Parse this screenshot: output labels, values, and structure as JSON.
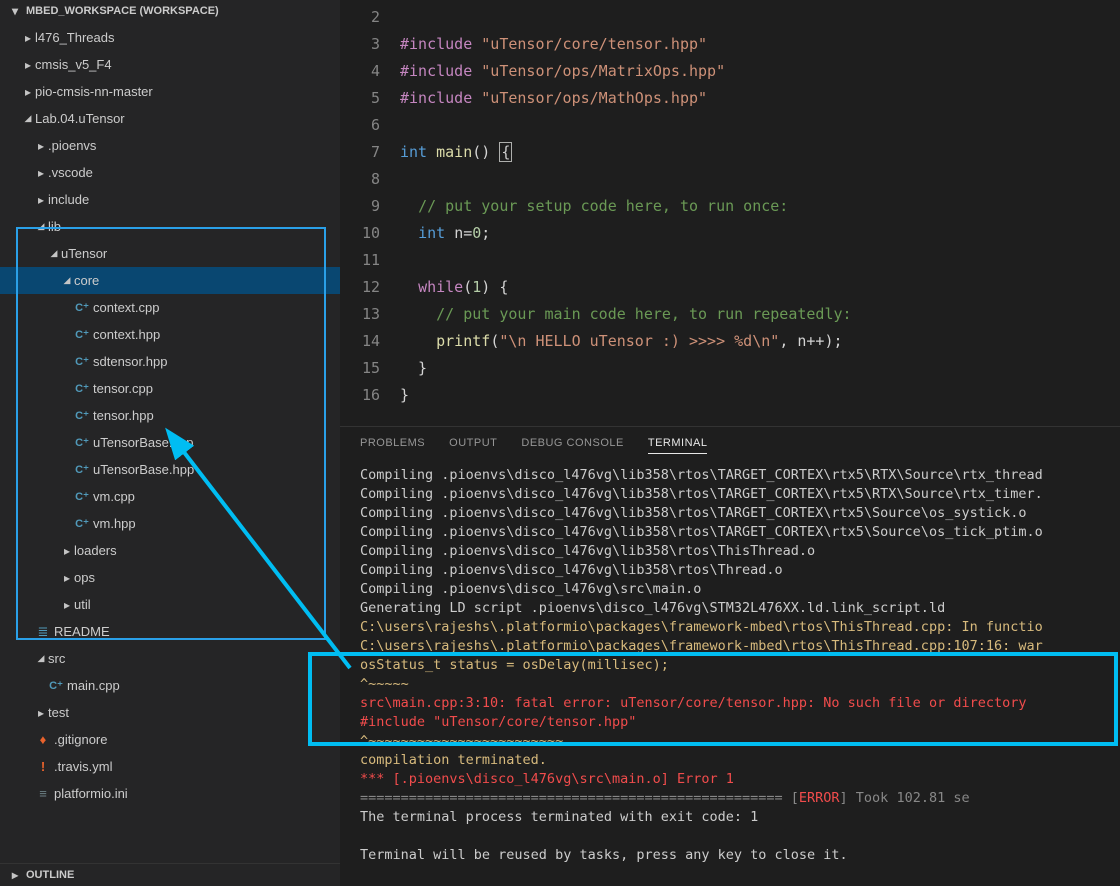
{
  "sidebar": {
    "workspace_title": "MBED_WORKSPACE (WORKSPACE)",
    "outline_title": "OUTLINE",
    "tree": [
      {
        "depth": 1,
        "type": "folder",
        "open": false,
        "label": "l476_Threads"
      },
      {
        "depth": 1,
        "type": "folder",
        "open": false,
        "label": "cmsis_v5_F4"
      },
      {
        "depth": 1,
        "type": "folder",
        "open": false,
        "label": "pio-cmsis-nn-master"
      },
      {
        "depth": 1,
        "type": "folder",
        "open": true,
        "label": "Lab.04.uTensor"
      },
      {
        "depth": 2,
        "type": "folder",
        "open": false,
        "label": ".pioenvs"
      },
      {
        "depth": 2,
        "type": "folder",
        "open": false,
        "label": ".vscode"
      },
      {
        "depth": 2,
        "type": "folder",
        "open": false,
        "label": "include"
      },
      {
        "depth": 2,
        "type": "folder",
        "open": true,
        "label": "lib"
      },
      {
        "depth": 3,
        "type": "folder",
        "open": true,
        "label": "uTensor"
      },
      {
        "depth": 4,
        "type": "folder",
        "open": true,
        "label": "core",
        "selected": true
      },
      {
        "depth": 5,
        "type": "file",
        "icon": "cpp",
        "label": "context.cpp"
      },
      {
        "depth": 5,
        "type": "file",
        "icon": "cpp",
        "label": "context.hpp"
      },
      {
        "depth": 5,
        "type": "file",
        "icon": "cpp",
        "label": "sdtensor.hpp"
      },
      {
        "depth": 5,
        "type": "file",
        "icon": "cpp",
        "label": "tensor.cpp"
      },
      {
        "depth": 5,
        "type": "file",
        "icon": "cpp",
        "label": "tensor.hpp"
      },
      {
        "depth": 5,
        "type": "file",
        "icon": "cpp",
        "label": "uTensorBase.cpp"
      },
      {
        "depth": 5,
        "type": "file",
        "icon": "cpp",
        "label": "uTensorBase.hpp"
      },
      {
        "depth": 5,
        "type": "file",
        "icon": "cpp",
        "label": "vm.cpp"
      },
      {
        "depth": 5,
        "type": "file",
        "icon": "cpp",
        "label": "vm.hpp"
      },
      {
        "depth": 4,
        "type": "folder",
        "open": false,
        "label": "loaders"
      },
      {
        "depth": 4,
        "type": "folder",
        "open": false,
        "label": "ops"
      },
      {
        "depth": 4,
        "type": "folder",
        "open": false,
        "label": "util"
      },
      {
        "depth": 2,
        "type": "file",
        "icon": "md",
        "label": "README"
      },
      {
        "depth": 2,
        "type": "folder",
        "open": true,
        "label": "src"
      },
      {
        "depth": 3,
        "type": "file",
        "icon": "cpp",
        "label": "main.cpp"
      },
      {
        "depth": 2,
        "type": "folder",
        "open": false,
        "label": "test"
      },
      {
        "depth": 2,
        "type": "file",
        "icon": "git",
        "label": ".gitignore"
      },
      {
        "depth": 2,
        "type": "file",
        "icon": "yml",
        "label": ".travis.yml"
      },
      {
        "depth": 2,
        "type": "file",
        "icon": "ini",
        "label": "platformio.ini"
      }
    ]
  },
  "editor": {
    "lines": [
      {
        "n": 2,
        "tokens": []
      },
      {
        "n": 3,
        "tokens": [
          [
            "pp",
            "#include"
          ],
          [
            "punc",
            " "
          ],
          [
            "str",
            "\"uTensor/core/tensor.hpp\""
          ]
        ]
      },
      {
        "n": 4,
        "tokens": [
          [
            "pp",
            "#include"
          ],
          [
            "punc",
            " "
          ],
          [
            "str",
            "\"uTensor/ops/MatrixOps.hpp\""
          ]
        ]
      },
      {
        "n": 5,
        "tokens": [
          [
            "pp",
            "#include"
          ],
          [
            "punc",
            " "
          ],
          [
            "str",
            "\"uTensor/ops/MathOps.hpp\""
          ]
        ]
      },
      {
        "n": 6,
        "tokens": []
      },
      {
        "n": 7,
        "tokens": [
          [
            "type",
            "int"
          ],
          [
            "punc",
            " "
          ],
          [
            "fn",
            "main"
          ],
          [
            "punc",
            "() "
          ],
          [
            "cursor",
            "{"
          ]
        ]
      },
      {
        "n": 8,
        "tokens": []
      },
      {
        "n": 9,
        "tokens": [
          [
            "punc",
            "  "
          ],
          [
            "comment",
            "// put your setup code here, to run once:"
          ]
        ]
      },
      {
        "n": 10,
        "tokens": [
          [
            "punc",
            "  "
          ],
          [
            "type",
            "int"
          ],
          [
            "punc",
            " "
          ],
          [
            "id",
            "n"
          ],
          [
            "punc",
            "="
          ],
          [
            "num",
            "0"
          ],
          [
            "punc",
            ";"
          ]
        ]
      },
      {
        "n": 11,
        "tokens": []
      },
      {
        "n": 12,
        "tokens": [
          [
            "punc",
            "  "
          ],
          [
            "kw",
            "while"
          ],
          [
            "punc",
            "("
          ],
          [
            "num",
            "1"
          ],
          [
            "punc",
            ") {"
          ]
        ]
      },
      {
        "n": 13,
        "tokens": [
          [
            "punc",
            "    "
          ],
          [
            "comment",
            "// put your main code here, to run repeatedly:"
          ]
        ]
      },
      {
        "n": 14,
        "tokens": [
          [
            "punc",
            "    "
          ],
          [
            "fn",
            "printf"
          ],
          [
            "punc",
            "("
          ],
          [
            "str",
            "\"\\n HELLO uTensor :) >>>> %d\\n\""
          ],
          [
            "punc",
            ", n++);"
          ]
        ]
      },
      {
        "n": 15,
        "tokens": [
          [
            "punc",
            "  }"
          ]
        ]
      },
      {
        "n": 16,
        "tokens": [
          [
            "punc",
            "}"
          ]
        ]
      }
    ]
  },
  "panel": {
    "tabs": [
      "PROBLEMS",
      "OUTPUT",
      "DEBUG CONSOLE",
      "TERMINAL"
    ],
    "active_tab": "TERMINAL",
    "terminal": [
      {
        "cls": "",
        "text": "Compiling .pioenvs\\disco_l476vg\\lib358\\rtos\\TARGET_CORTEX\\rtx5\\RTX\\Source\\rtx_thread"
      },
      {
        "cls": "",
        "text": "Compiling .pioenvs\\disco_l476vg\\lib358\\rtos\\TARGET_CORTEX\\rtx5\\RTX\\Source\\rtx_timer."
      },
      {
        "cls": "",
        "text": "Compiling .pioenvs\\disco_l476vg\\lib358\\rtos\\TARGET_CORTEX\\rtx5\\Source\\os_systick.o"
      },
      {
        "cls": "",
        "text": "Compiling .pioenvs\\disco_l476vg\\lib358\\rtos\\TARGET_CORTEX\\rtx5\\Source\\os_tick_ptim.o"
      },
      {
        "cls": "",
        "text": "Compiling .pioenvs\\disco_l476vg\\lib358\\rtos\\ThisThread.o"
      },
      {
        "cls": "",
        "text": "Compiling .pioenvs\\disco_l476vg\\lib358\\rtos\\Thread.o"
      },
      {
        "cls": "",
        "text": "Compiling .pioenvs\\disco_l476vg\\src\\main.o"
      },
      {
        "cls": "",
        "text": "Generating LD script .pioenvs\\disco_l476vg\\STM32L476XX.ld.link_script.ld"
      },
      {
        "cls": "yellow",
        "text": "C:\\users\\rajeshs\\.platformio\\packages\\framework-mbed\\rtos\\ThisThread.cpp: In functio"
      },
      {
        "cls": "yellow",
        "text": "C:\\users\\rajeshs\\.platformio\\packages\\framework-mbed\\rtos\\ThisThread.cpp:107:16: war"
      },
      {
        "cls": "yellow",
        "text": "osStatus_t status = osDelay(millisec);"
      },
      {
        "cls": "yellow",
        "text": "^~~~~~"
      },
      {
        "cls": "red",
        "text": "src\\main.cpp:3:10: fatal error: uTensor/core/tensor.hpp: No such file or directory"
      },
      {
        "cls": "red",
        "text": "#include \"uTensor/core/tensor.hpp\""
      },
      {
        "cls": "yellow",
        "text": "^~~~~~~~~~~~~~~~~~~~~~~~~"
      },
      {
        "cls": "yellow",
        "text": "compilation terminated."
      },
      {
        "cls": "red",
        "text": "*** [.pioenvs\\disco_l476vg\\src\\main.o] Error 1"
      },
      {
        "cls": "mixed",
        "parts": [
          {
            "cls": "gray",
            "text": "==================================================== ["
          },
          {
            "cls": "red",
            "text": "ERROR"
          },
          {
            "cls": "gray",
            "text": "] Took 102.81 se"
          }
        ]
      },
      {
        "cls": "",
        "text": "The terminal process terminated with exit code: 1"
      },
      {
        "cls": "",
        "text": ""
      },
      {
        "cls": "",
        "text": "Terminal will be reused by tasks, press any key to close it."
      }
    ]
  }
}
